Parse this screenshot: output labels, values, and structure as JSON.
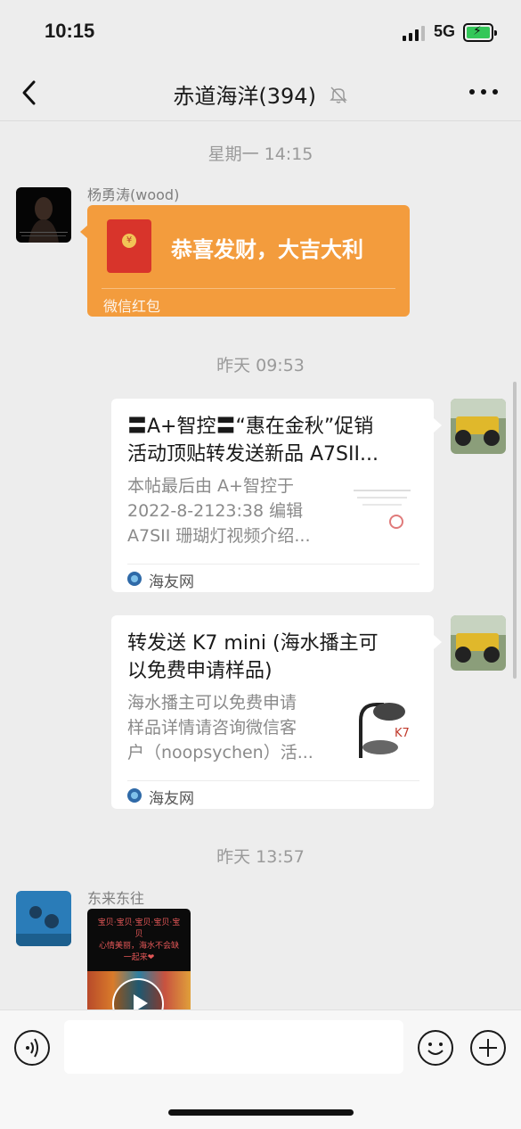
{
  "status_bar": {
    "time": "10:15",
    "network": "5G",
    "battery_icon": "battery-charging-icon"
  },
  "nav": {
    "title": "赤道海洋(394)",
    "back_icon": "chevron-left-icon",
    "mute_icon": "bell-muted-icon",
    "more_icon": "more-dots-icon"
  },
  "messages": {
    "ts1": "星期一 14:15",
    "sender1": "杨勇涛(wood)",
    "redpacket": {
      "text": "恭喜发财，大吉大利",
      "label": "微信红包",
      "color": "#f39c3d"
    },
    "ts2": "昨天 09:53",
    "card1": {
      "title": "〓A+智控〓“惠在金秋”促销\n活动顶贴转发送新品 A7SII...",
      "desc": "本帖最后由 A+智控于\n2022-8-2123:38 编辑\nA7SII 珊瑚灯视频介绍...",
      "source": "海友网"
    },
    "card2": {
      "title": "转发送 K7 mini (海水播主可\n以免费申请样品)",
      "desc": "海水播主可以免费申请\n样品详情请咨询微信客\n户（noopsychen）活...",
      "source": "海友网"
    },
    "ts3": "昨天 13:57",
    "sender2": "东来东往",
    "video_text": "宝贝·宝贝·宝贝·宝贝·宝贝\n心情美丽，海水不会缺\n一起来❤"
  },
  "input_bar": {
    "voice_icon": "voice-icon",
    "emoji_icon": "emoji-icon",
    "plus_icon": "plus-icon"
  }
}
